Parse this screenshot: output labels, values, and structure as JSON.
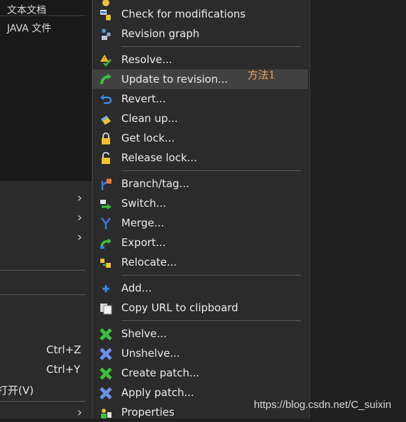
{
  "left_menu": {
    "file_type_1": "文本文档",
    "file_type_2": "JAVA 文件",
    "undo_shortcut": "Ctrl+Z",
    "redo_shortcut": "Ctrl+Y",
    "open_label": "打开(V)"
  },
  "svn_menu": {
    "check_modifications": "Check for modifications",
    "revision_graph": "Revision graph",
    "resolve": "Resolve...",
    "update_to_revision": "Update to revision...",
    "revert": "Revert...",
    "clean_up": "Clean up...",
    "get_lock": "Get lock...",
    "release_lock": "Release lock...",
    "branch_tag": "Branch/tag...",
    "switch": "Switch...",
    "merge": "Merge...",
    "export": "Export...",
    "relocate": "Relocate...",
    "add": "Add...",
    "copy_url": "Copy URL to clipboard",
    "shelve": "Shelve...",
    "unshelve": "Unshelve...",
    "create_patch": "Create patch...",
    "apply_patch": "Apply patch...",
    "properties": "Properties"
  },
  "annotation": "方法1",
  "watermark": "https://blog.csdn.net/C_suixin",
  "icons": {
    "check_modifications": "check-modifications-icon",
    "revision_graph": "revision-graph-icon",
    "resolve": "resolve-icon",
    "update_to_revision": "update-icon",
    "revert": "revert-icon",
    "clean_up": "cleanup-icon",
    "get_lock": "lock-icon",
    "release_lock": "unlock-icon",
    "branch_tag": "branch-icon",
    "switch": "switch-icon",
    "merge": "merge-icon",
    "export": "export-icon",
    "relocate": "relocate-icon",
    "add": "add-icon",
    "copy_url": "copy-icon",
    "shelve": "shelve-icon",
    "unshelve": "unshelve-icon",
    "create_patch": "patch-icon",
    "apply_patch": "apply-patch-icon",
    "properties": "properties-icon"
  },
  "colors": {
    "menu_bg": "#2b2b2b",
    "hover_bg": "#414141",
    "annotation": "#f0a050"
  }
}
